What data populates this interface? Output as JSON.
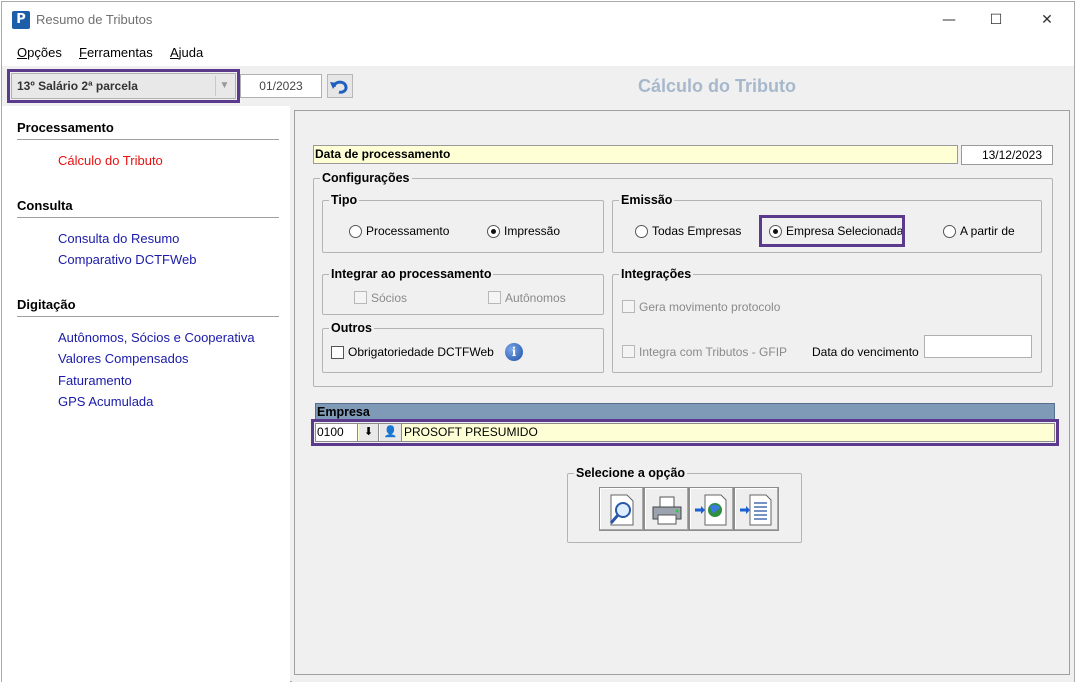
{
  "window": {
    "title": "Resumo de Tributos",
    "app_icon_letter": "P",
    "controls": {
      "minimize": "—",
      "maximize": "☐",
      "close": "✕"
    }
  },
  "menu": {
    "items": [
      {
        "label": "Opções",
        "underline": "O",
        "rest": "pções"
      },
      {
        "label": "Ferramentas",
        "underline": "F",
        "rest": "erramentas"
      },
      {
        "label": "Ajuda",
        "underline": "A",
        "rest": "juda"
      }
    ]
  },
  "toolbar": {
    "tipo_value": "13º Salário 2ª parcela",
    "period": "01/2023",
    "page_heading": "Cálculo do Tributo"
  },
  "sidebar": {
    "sections": [
      {
        "title": "Processamento",
        "items": [
          "Cálculo do Tributo"
        ]
      },
      {
        "title": "Consulta",
        "items": [
          "Consulta do Resumo",
          "Comparativo DCTFWeb"
        ]
      },
      {
        "title": "Digitação",
        "items": [
          "Autônomos, Sócios e Cooperativa",
          "Valores Compensados",
          "Faturamento",
          "GPS Acumulada"
        ]
      }
    ],
    "active_item": "Cálculo do Tributo"
  },
  "main": {
    "data_processamento_label": "Data de processamento",
    "data_processamento_value": "13/12/2023",
    "configuracoes": {
      "legend": "Configurações",
      "tipo": {
        "legend": "Tipo",
        "options": [
          "Processamento",
          "Impressão"
        ],
        "selected": "Impressão"
      },
      "emissao": {
        "legend": "Emissão",
        "options": [
          "Todas Empresas",
          "Empresa Selecionada",
          "A partir de"
        ],
        "selected": "Empresa Selecionada"
      },
      "integrar": {
        "legend": "Integrar ao processamento",
        "options": [
          "Sócios",
          "Autônomos"
        ]
      },
      "integracoes": {
        "legend": "Integrações",
        "gera_movimento": "Gera movimento protocolo",
        "integra_gfip": "Integra com Tributos - GFIP",
        "data_vencimento_label": "Data do vencimento",
        "data_vencimento_value": ""
      },
      "outros": {
        "legend": "Outros",
        "obrigatoriedade": "Obrigatoriedade DCTFWeb",
        "info_icon_glyph": "i"
      }
    },
    "empresa": {
      "header": "Empresa",
      "code": "0100",
      "name": "PROSOFT PRESUMIDO",
      "download_glyph": "⬇",
      "search_glyph": "👤"
    },
    "opcoes": {
      "legend": "Selecione a opção",
      "buttons": [
        "preview-icon",
        "printer-icon",
        "export-globe-icon",
        "export-document-icon"
      ]
    }
  },
  "colors": {
    "highlight_frame": "#5b3a8e",
    "active_link": "#e81010",
    "nav_link": "#1a1aa8",
    "heading": "#a8b8cc",
    "empresa_header": "#7f9ab6",
    "field_yellow": "#ffffd6"
  }
}
